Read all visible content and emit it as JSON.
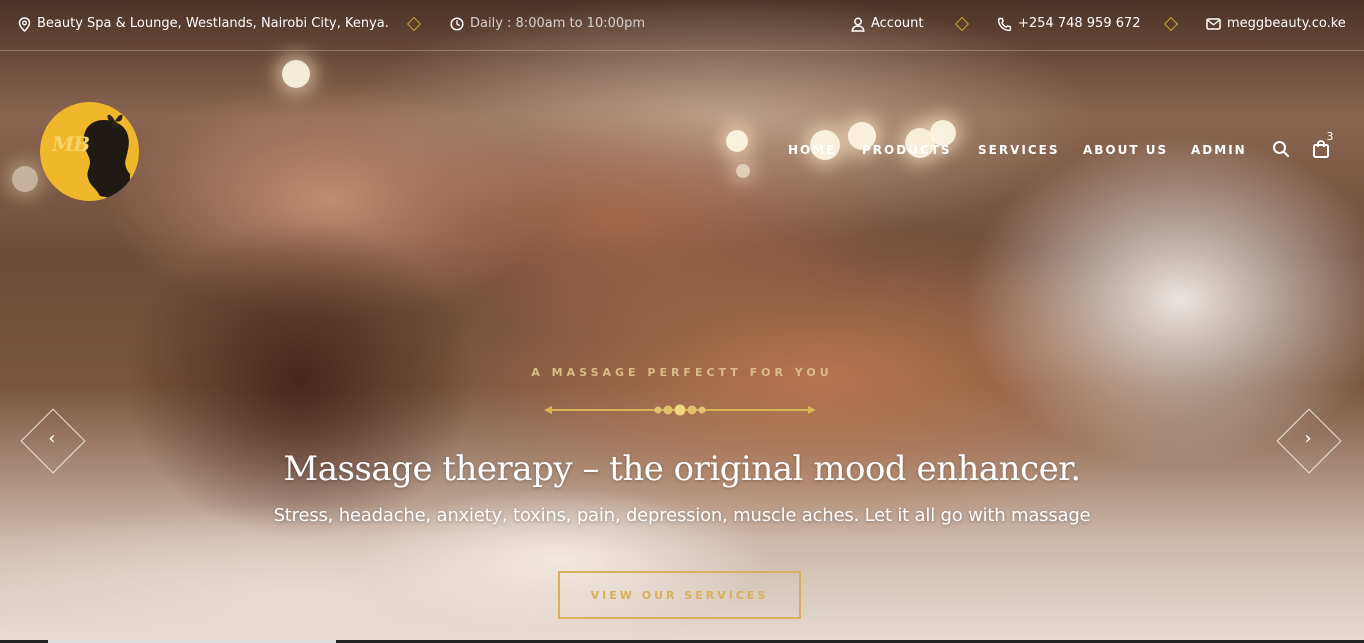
{
  "topbar": {
    "address": "Beauty Spa & Lounge, Westlands, Nairobi City, Kenya.",
    "hours": "Daily : 8:00am to 10:00pm",
    "account": "Account",
    "phone": "+254 748 959 672",
    "email": "meggbeauty.co.ke"
  },
  "logo": {
    "text": "MB"
  },
  "nav": {
    "items": [
      {
        "label": "HOME"
      },
      {
        "label": "PRODUCTS"
      },
      {
        "label": "SERVICES"
      },
      {
        "label": "ABOUT US"
      },
      {
        "label": "ADMIN"
      }
    ],
    "cart_count": "3",
    "icons": {
      "search": "search-icon",
      "cart": "shopping-bag-icon"
    }
  },
  "hero": {
    "eyebrow": "A MASSAGE PERFECTT FOR YOU",
    "headline": "Massage therapy – the original mood enhancer.",
    "subline": "Stress, headache, anxiety, toxins, pain, depression, muscle aches. Let it all go with massage",
    "cta": "VIEW OUR SERVICES",
    "prev_icon": "chevron-left-icon",
    "next_icon": "chevron-right-icon"
  },
  "colors": {
    "accent_gold": "#d6b15a",
    "logo_yellow": "#f0b72a",
    "text_white": "#ffffff"
  }
}
